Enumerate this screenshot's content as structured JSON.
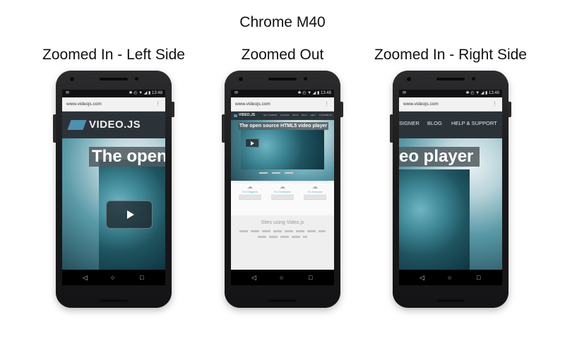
{
  "figure_title": "Chrome M40",
  "columns": [
    {
      "title": "Zoomed In - Left Side",
      "status_time": "13:48",
      "url": "www.videojs.com",
      "logo": "VIDEO.JS",
      "headline": "The open"
    },
    {
      "title": "Zoomed Out",
      "status_time": "13:48",
      "url": "www.videojs.com",
      "logo": "VIDEO.JS",
      "headline": "The open source HTML5 video player",
      "nav_items": [
        "GET STARTED",
        "PLUGINS",
        "DOCS",
        "BLOG",
        "HELP",
        "CONTRIBUTE"
      ],
      "features": [
        "For Designers",
        "For Developers",
        "For Everyone"
      ],
      "sites_heading": "Sites using Video.js"
    },
    {
      "title": "Zoomed In - Right Side",
      "status_time": "13:48",
      "url": "www.videojs.com",
      "nav_items": [
        "SIGNER",
        "BLOG",
        "HELP & SUPPORT"
      ],
      "headline": "eo player"
    }
  ],
  "icons": {
    "back": "◁",
    "home": "○",
    "recents": "□",
    "menu": "⋮",
    "status_left": "✉",
    "status_right": "✱ ◴ ▼ ◢ ▮"
  }
}
